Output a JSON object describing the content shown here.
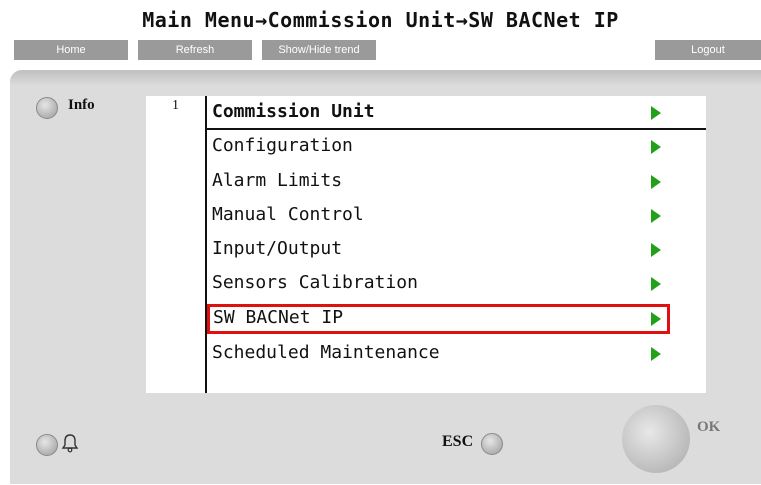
{
  "breadcrumb": "Main Menu→Commission Unit→SW BACNet IP",
  "toolbar": {
    "home": "Home",
    "refresh": "Refresh",
    "trend": "Show/Hide trend",
    "logout": "Logout"
  },
  "info_label": "Info",
  "row_number": "1",
  "menu": {
    "header": "Commission Unit",
    "items": [
      "Configuration",
      "Alarm Limits",
      "Manual Control",
      "Input/Output",
      "Sensors Calibration",
      "SW BACNet IP",
      "Scheduled Maintenance"
    ],
    "selected": "SW BACNet IP"
  },
  "esc_label": "ESC",
  "ok_label": "OK",
  "colors": {
    "arrow": "#22a01a",
    "highlight": "#e01010",
    "panel": "#dcdcdc",
    "button": "#9a9a9a"
  }
}
